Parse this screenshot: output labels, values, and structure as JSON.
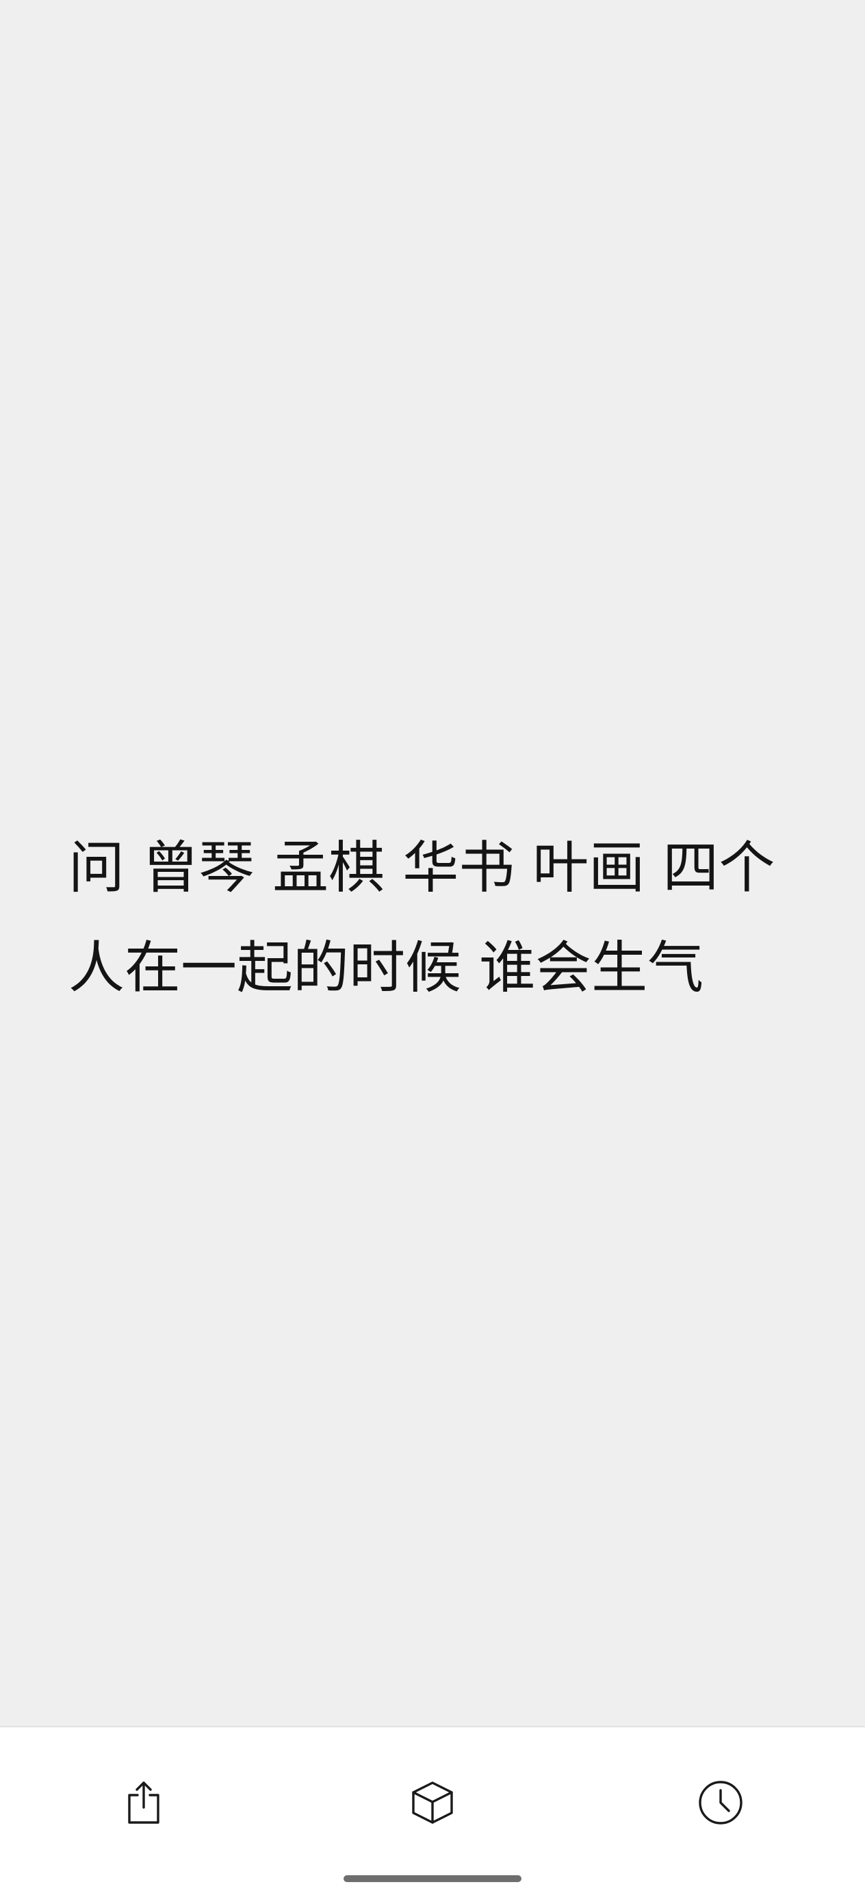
{
  "content": {
    "riddle_text": "问 曾琴 孟棋 华书 叶画 四个人在一起的时候 谁会生气"
  },
  "toolbar": {
    "buttons": [
      {
        "icon": "share-icon"
      },
      {
        "icon": "box-icon"
      },
      {
        "icon": "clock-icon"
      }
    ]
  },
  "colors": {
    "background": "#efefef",
    "toolbar_background": "#ffffff",
    "text": "#141414",
    "home_indicator": "#6e6e6e"
  }
}
